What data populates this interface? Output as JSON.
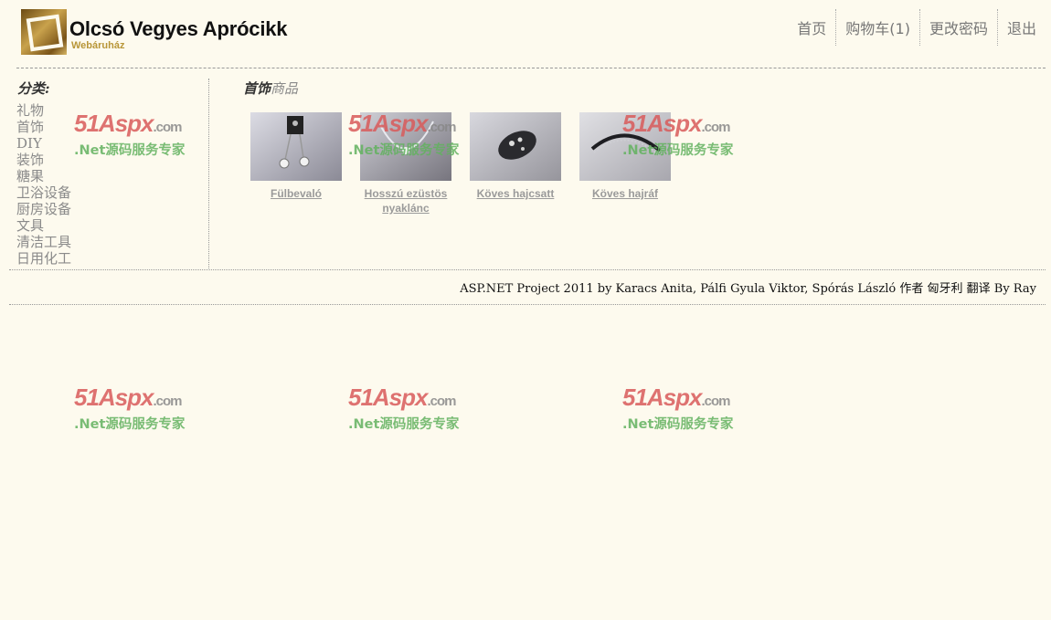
{
  "header": {
    "title": "Olcsó Vegyes Aprócikk",
    "subtitle": "Webáruház",
    "nav": [
      "首页",
      "购物车(1)",
      "更改密码",
      "退出"
    ]
  },
  "sidebar": {
    "title": "分类:",
    "categories": [
      "礼物",
      "首饰",
      "DIY",
      "装饰",
      "糖果",
      "卫浴设备",
      "厨房设备",
      "文具",
      "清洁工具",
      "日用化工"
    ]
  },
  "main": {
    "title_part1": "首饰",
    "title_part2": "商品",
    "products": [
      {
        "name": "Fülbevaló",
        "icon": "earrings-image"
      },
      {
        "name": "Hosszú ezüstös nyaklánc",
        "icon": "necklace-image"
      },
      {
        "name": "Köves hajcsatt",
        "icon": "hairclip-image"
      },
      {
        "name": "Köves hajráf",
        "icon": "headband-image"
      }
    ]
  },
  "footer": {
    "text": "ASP.NET Project 2011 by Karacs Anita, Pálfi Gyula Viktor, Spórás László 作者 匈牙利 翻译 By Ray"
  },
  "watermark": {
    "line1": "51Aspx",
    "line1_suffix": ".com",
    "line2": ".Net源码服务专家"
  },
  "colors": {
    "background": "#fdfaee",
    "text_gray": "#8a8a8a",
    "watermark_red": "#d95b5b",
    "watermark_green": "#62b25f",
    "logo_gold": "#b89638"
  }
}
